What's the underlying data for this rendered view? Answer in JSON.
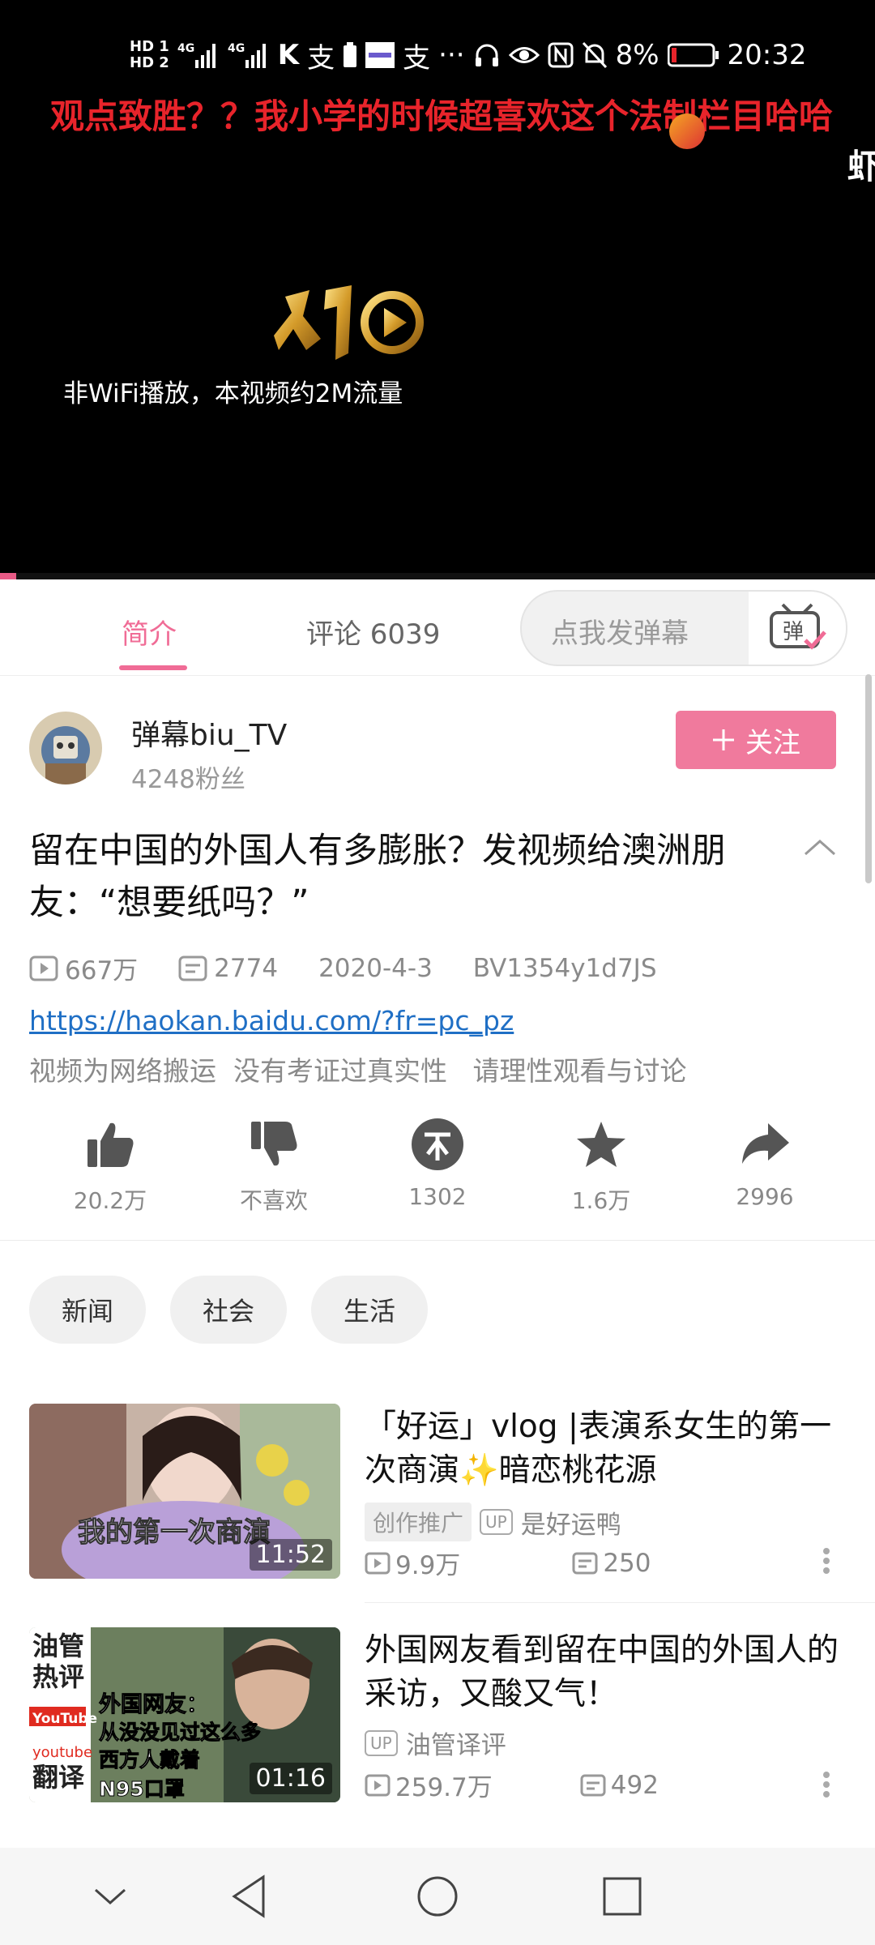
{
  "status_bar": {
    "network1": "HD 1",
    "network2": "HD 2",
    "signal1": "4G",
    "signal2": "4G",
    "battery_percent": "8%",
    "time": "20:32"
  },
  "video": {
    "danmaku_line1": "观点致胜？？我小学的时候超喜欢这个法制栏目哈哈",
    "danmaku_line2": "虾",
    "wifi_note": "非WiFi播放，本视频约2M流量"
  },
  "tabs": {
    "intro": "简介",
    "comments": "评论 6039",
    "danmu_placeholder": "点我发弹幕",
    "danmu_button": "弹"
  },
  "uploader": {
    "name": "弹幕biu_TV",
    "fans": "4248粉丝",
    "follow": "关注"
  },
  "video_info": {
    "title": "留在中国的外国人有多膨胀？发视频给澳洲朋友：“想要纸吗？”",
    "plays": "667万",
    "danmaku_count": "2774",
    "date": "2020-4-3",
    "bvid": "BV1354y1d7JS",
    "link": "https://haokan.baidu.com/?fr=pc_pz",
    "description": "视频为网络搬运  没有考证过真实性   请理性观看与讨论"
  },
  "actions": {
    "like": "20.2万",
    "dislike": "不喜欢",
    "coin": "1302",
    "favorite": "1.6万",
    "share": "2996"
  },
  "tags": [
    "新闻",
    "社会",
    "生活"
  ],
  "related": [
    {
      "title": "「好运」vlog |表演系女生的第一次商演✨暗恋桃花源",
      "badge": "创作推广",
      "up_tag": "UP",
      "uploader": "是好运鸭",
      "plays": "9.9万",
      "danmaku": "250",
      "duration": "11:52",
      "thumb_caption": "我的第一次商演"
    },
    {
      "title": "外国网友看到留在中国的外国人的采访，又酸又气！",
      "up_tag": "UP",
      "uploader": "油管译评",
      "plays": "259.7万",
      "danmaku": "492",
      "duration": "01:16",
      "thumb_caption1": "外国网友：",
      "thumb_caption2": "从没没见过这么多",
      "thumb_caption3": "西方人戴着",
      "thumb_caption4": "N95口罩",
      "thumb_side1": "油管",
      "thumb_side2": "热评",
      "thumb_side3": "YouTube",
      "thumb_side4": "youtube",
      "thumb_side5": "翻译"
    }
  ],
  "colors": {
    "accent": "#f06c96",
    "danmaku_red": "#e8242b",
    "link": "#1f6fc5"
  }
}
